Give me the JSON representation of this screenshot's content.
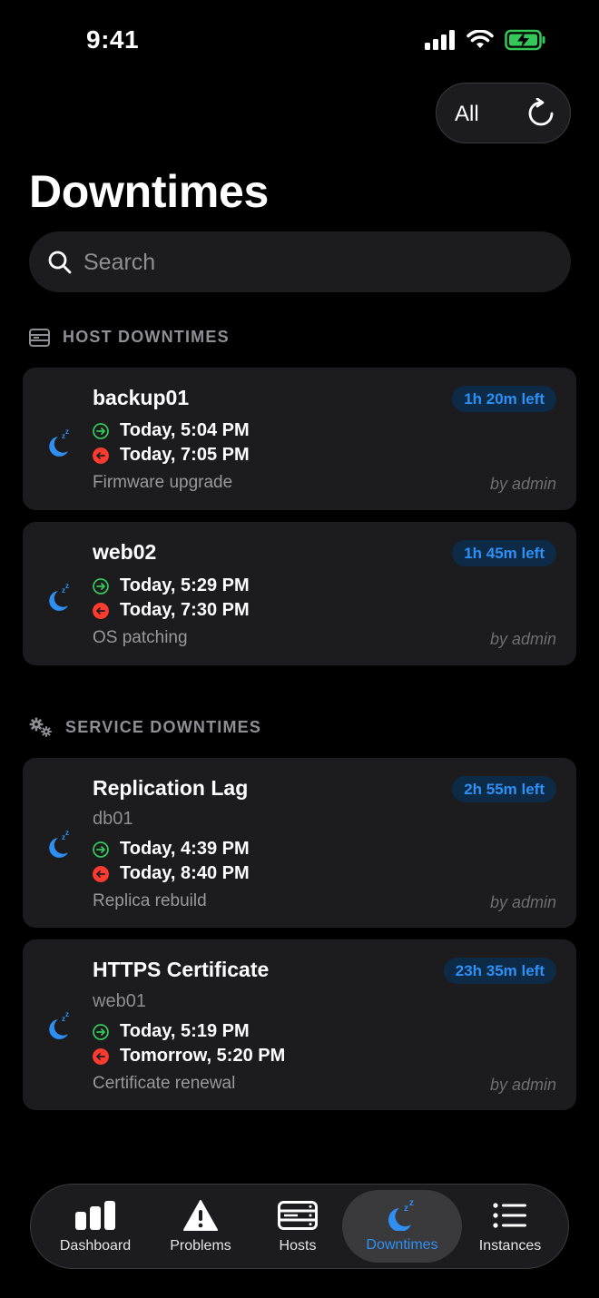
{
  "status": {
    "time": "9:41"
  },
  "filter": {
    "label": "All"
  },
  "title": "Downtimes",
  "search": {
    "placeholder": "Search",
    "value": ""
  },
  "sections": {
    "host": {
      "title": "HOST DOWNTIMES",
      "cards": [
        {
          "title": "backup01",
          "badge": "1h 20m left",
          "start": "Today, 5:04 PM",
          "end": "Today, 7:05 PM",
          "desc": "Firmware upgrade",
          "author": "by admin"
        },
        {
          "title": "web02",
          "badge": "1h 45m left",
          "start": "Today, 5:29 PM",
          "end": "Today, 7:30 PM",
          "desc": "OS patching",
          "author": "by admin"
        }
      ]
    },
    "service": {
      "title": "SERVICE DOWNTIMES",
      "cards": [
        {
          "title": "Replication Lag",
          "host": "db01",
          "badge": "2h 55m left",
          "start": "Today, 4:39 PM",
          "end": "Today, 8:40 PM",
          "desc": "Replica rebuild",
          "author": "by admin"
        },
        {
          "title": "HTTPS Certificate",
          "host": "web01",
          "badge": "23h 35m left",
          "start": "Today, 5:19 PM",
          "end": "Tomorrow, 5:20 PM",
          "desc": "Certificate renewal",
          "author": "by admin"
        }
      ]
    }
  },
  "tabs": [
    {
      "label": "Dashboard",
      "icon": "bar-chart-icon"
    },
    {
      "label": "Problems",
      "icon": "warning-icon"
    },
    {
      "label": "Hosts",
      "icon": "server-icon"
    },
    {
      "label": "Downtimes",
      "icon": "moon-sleep-icon",
      "active": true
    },
    {
      "label": "Instances",
      "icon": "list-icon"
    }
  ],
  "colors": {
    "accent": "#2f8ff3",
    "start": "#34c759",
    "end": "#ff3b30",
    "card": "#1c1c1e"
  }
}
